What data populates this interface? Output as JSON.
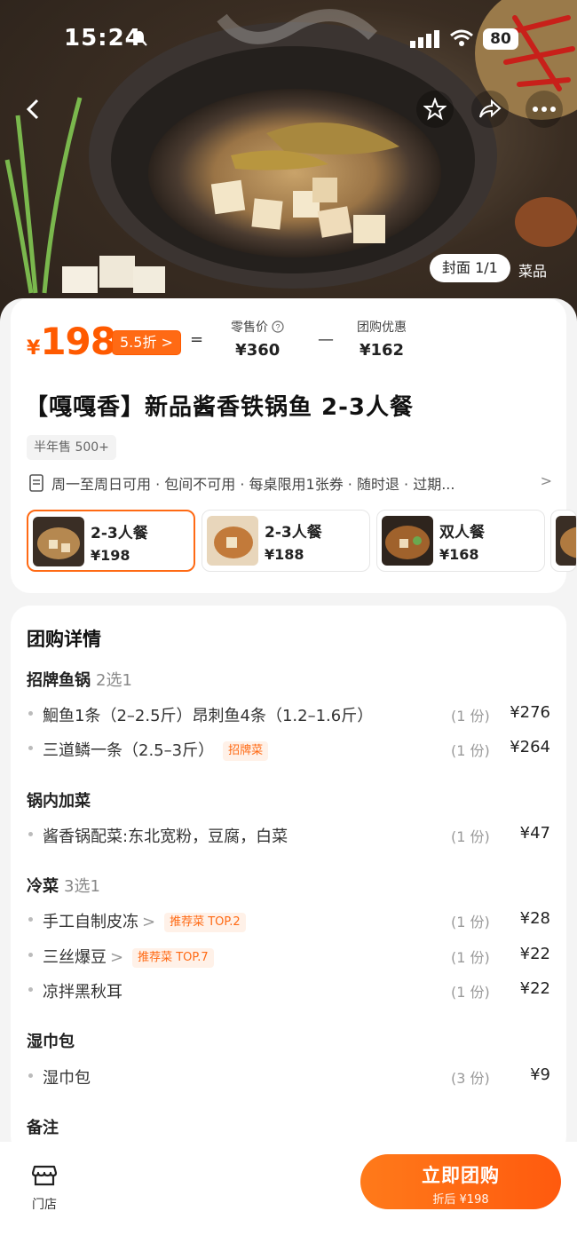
{
  "status_bar": {
    "time": "15:24",
    "battery": "80"
  },
  "hero": {
    "cover_label": "封面 1/1",
    "menu_label": "菜品"
  },
  "price": {
    "symbol": "¥",
    "value": "198",
    "discount": "5.5折 >",
    "equals": "=",
    "minus": "—",
    "retail_label": "零售价",
    "retail_value": "¥360",
    "promo_label": "团购优惠",
    "promo_value": "¥162"
  },
  "product": {
    "title": "【嘎嘎香】新品酱香铁锅鱼 2-3人餐",
    "sold": "半年售 500+",
    "rules": "周一至周日可用 · 包间不可用 · 每桌限用1张券 · 随时退 · 过期...",
    "rules_chevron": ">"
  },
  "packages": [
    {
      "name": "2-3人餐",
      "price": "¥198",
      "selected": true
    },
    {
      "name": "2-3人餐",
      "price": "¥188",
      "selected": false
    },
    {
      "name": "双人餐",
      "price": "¥168",
      "selected": false
    }
  ],
  "details": {
    "title": "团购详情",
    "groups": [
      {
        "name": "招牌鱼锅",
        "sub": "2选1",
        "items": [
          {
            "name": "鮰鱼1条（2–2.5斤）昂刺鱼4条（1.2–1.6斤）",
            "qty": "(1 份)",
            "price": "¥276"
          },
          {
            "name": "三道鳞一条（2.5–3斤）",
            "tag": "招牌菜",
            "qty": "(1 份)",
            "price": "¥264"
          }
        ]
      },
      {
        "name": "锅内加菜",
        "items": [
          {
            "name": "酱香锅配菜:东北宽粉，豆腐，白菜",
            "qty": "(1 份)",
            "price": "¥47"
          }
        ]
      },
      {
        "name": "冷菜",
        "sub": "3选1",
        "items": [
          {
            "name": "手工自制皮冻",
            "arrow": ">",
            "tag": "推荐菜 TOP.2",
            "qty": "(1 份)",
            "price": "¥28"
          },
          {
            "name": "三丝爆豆",
            "arrow": ">",
            "tag": "推荐菜 TOP.7",
            "qty": "(1 份)",
            "price": "¥22"
          },
          {
            "name": "凉拌黑秋耳",
            "qty": "(1 份)",
            "price": "¥22"
          }
        ]
      },
      {
        "name": "湿巾包",
        "items": [
          {
            "name": "湿巾包",
            "qty": "(3 份)",
            "price": "¥9"
          }
        ]
      },
      {
        "name": "备注",
        "items": []
      }
    ]
  },
  "bottom_bar": {
    "store_label": "门店",
    "buy_label": "立即团购",
    "buy_sub": "折后 ¥198"
  },
  "colors": {
    "accent": "#ff5a00",
    "button": "#ff6a14"
  }
}
